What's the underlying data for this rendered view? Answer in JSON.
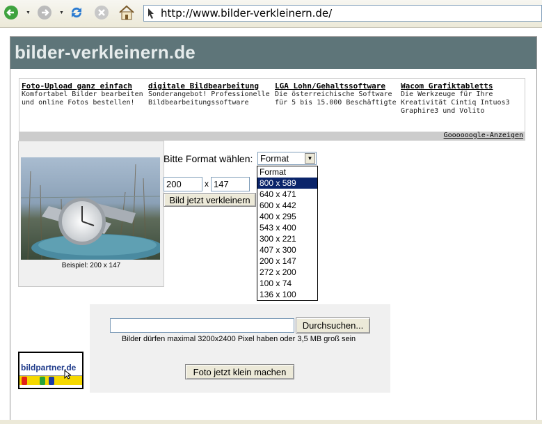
{
  "browser": {
    "url": "http://www.bilder-verkleinern.de/"
  },
  "site": {
    "title": "bilder-verkleinern.de"
  },
  "ads": {
    "items": [
      {
        "title": "Foto-Upload ganz einfach",
        "text": "Komfortabel Bilder bearbeiten und online Fotos bestellen!"
      },
      {
        "title": "digitale Bildbearbeitung",
        "text": "Sonderangebot! Professionelle Bildbearbeitungssoftware"
      },
      {
        "title": "LGA Lohn/Gehaltssoftware",
        "text": "Die österreichische Software für 5 bis 15.000 Beschäftigte"
      },
      {
        "title": "Wacom Grafiktabletts",
        "text": "Die Werkzeuge für Ihre Kreativität Cintiq Intuos3 Graphire3 und Volito"
      }
    ],
    "footer_link": "Goooooogle-Anzeigen"
  },
  "sample": {
    "caption": "Beispiel: 200 x 147"
  },
  "format": {
    "label": "Bitte Format wählen:",
    "selected": "Format",
    "options": [
      "Format",
      "800 x 589",
      "640 x 471",
      "600 x 442",
      "400 x 295",
      "543 x 400",
      "300 x 221",
      "407 x 300",
      "200 x 147",
      "272 x 200",
      "100 x 74",
      "136 x 100"
    ],
    "highlighted_index": 1
  },
  "dimensions": {
    "width": "200",
    "separator": "x",
    "height": "147"
  },
  "buttons": {
    "shrink": "Bild jetzt verkleinern",
    "browse": "Durchsuchen...",
    "submit": "Foto jetzt klein machen"
  },
  "upload": {
    "file_value": "",
    "note": "Bilder dürfen maximal 3200x2400 Pixel haben oder 3,5 MB groß sein"
  },
  "partner": {
    "logo_text": "bildpartner.de"
  }
}
